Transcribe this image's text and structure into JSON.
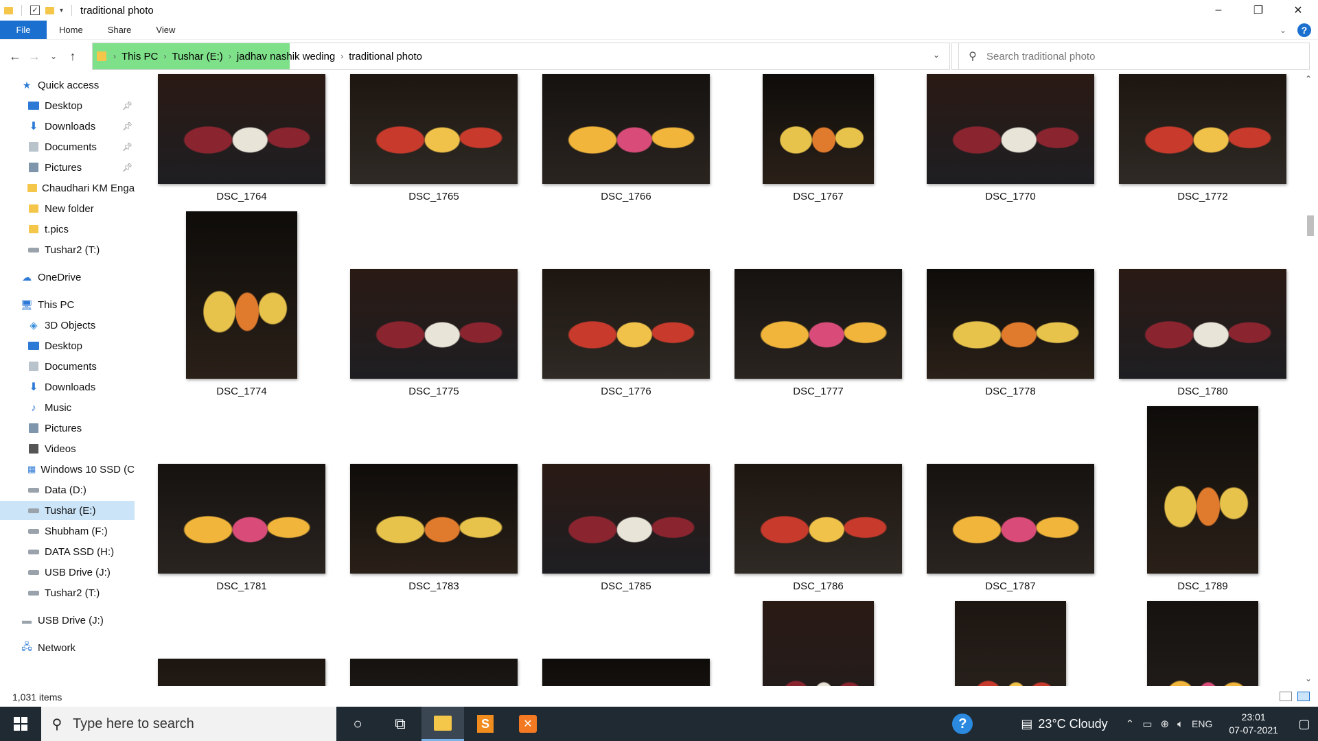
{
  "window": {
    "title": "traditional photo",
    "controls": [
      "–",
      "❐",
      "✕"
    ]
  },
  "ribbon": {
    "tabs": [
      "File",
      "Home",
      "Share",
      "View"
    ]
  },
  "address": {
    "crumbs": [
      "This PC",
      "Tushar (E:)",
      "jadhav nashik weding",
      "traditional photo"
    ],
    "progress_fraction": 0.23,
    "progress_color": "#7fe08a"
  },
  "search": {
    "placeholder": "Search traditional photo"
  },
  "navpane": {
    "quick_access": "Quick access",
    "quick_items": [
      {
        "label": "Desktop",
        "icon": "desktop-icon",
        "pinned": true
      },
      {
        "label": "Downloads",
        "icon": "download-icon",
        "pinned": true
      },
      {
        "label": "Documents",
        "icon": "documents-icon",
        "pinned": true
      },
      {
        "label": "Pictures",
        "icon": "pictures-icon",
        "pinned": true
      },
      {
        "label": "Chaudhari KM Enga",
        "icon": "folder-icon",
        "pinned": false
      },
      {
        "label": "New folder",
        "icon": "folder-icon",
        "pinned": false
      },
      {
        "label": "t.pics",
        "icon": "folder-icon",
        "pinned": false
      },
      {
        "label": "Tushar2 (T:)",
        "icon": "drive-icon",
        "pinned": false
      }
    ],
    "onedrive": "OneDrive",
    "this_pc": "This PC",
    "pc_items": [
      {
        "label": "3D Objects",
        "icon": "3d-objects-icon"
      },
      {
        "label": "Desktop",
        "icon": "desktop-icon"
      },
      {
        "label": "Documents",
        "icon": "documents-icon"
      },
      {
        "label": "Downloads",
        "icon": "download-icon"
      },
      {
        "label": "Music",
        "icon": "music-icon"
      },
      {
        "label": "Pictures",
        "icon": "pictures-icon"
      },
      {
        "label": "Videos",
        "icon": "videos-icon"
      },
      {
        "label": "Windows 10 SSD (C",
        "icon": "windows-drive-icon"
      },
      {
        "label": "Data (D:)",
        "icon": "drive-icon"
      },
      {
        "label": "Tushar (E:)",
        "icon": "drive-icon",
        "selected": true
      },
      {
        "label": "Shubham (F:)",
        "icon": "drive-icon"
      },
      {
        "label": "DATA SSD (H:)",
        "icon": "drive-icon"
      },
      {
        "label": "USB Drive (J:)",
        "icon": "drive-icon"
      },
      {
        "label": "Tushar2 (T:)",
        "icon": "drive-icon"
      }
    ],
    "usb": "USB Drive (J:)",
    "network": "Network"
  },
  "files": [
    {
      "name": "DSC_1764",
      "orientation": "landscape"
    },
    {
      "name": "DSC_1765",
      "orientation": "landscape"
    },
    {
      "name": "DSC_1766",
      "orientation": "landscape"
    },
    {
      "name": "DSC_1767",
      "orientation": "portrait"
    },
    {
      "name": "DSC_1770",
      "orientation": "landscape"
    },
    {
      "name": "DSC_1772",
      "orientation": "landscape"
    },
    {
      "name": "DSC_1774",
      "orientation": "portrait"
    },
    {
      "name": "DSC_1775",
      "orientation": "landscape"
    },
    {
      "name": "DSC_1776",
      "orientation": "landscape"
    },
    {
      "name": "DSC_1777",
      "orientation": "landscape"
    },
    {
      "name": "DSC_1778",
      "orientation": "landscape"
    },
    {
      "name": "DSC_1780",
      "orientation": "landscape"
    },
    {
      "name": "DSC_1781",
      "orientation": "landscape"
    },
    {
      "name": "DSC_1783",
      "orientation": "landscape"
    },
    {
      "name": "DSC_1785",
      "orientation": "landscape"
    },
    {
      "name": "DSC_1786",
      "orientation": "landscape"
    },
    {
      "name": "DSC_1787",
      "orientation": "landscape"
    },
    {
      "name": "DSC_1789",
      "orientation": "portrait"
    },
    {
      "name": "",
      "orientation": "landscape"
    },
    {
      "name": "",
      "orientation": "landscape"
    },
    {
      "name": "",
      "orientation": "landscape"
    },
    {
      "name": "",
      "orientation": "portrait"
    },
    {
      "name": "",
      "orientation": "portrait"
    },
    {
      "name": "",
      "orientation": "portrait"
    }
  ],
  "status": {
    "item_count": "1,031 items"
  },
  "taskbar": {
    "search_placeholder": "Type here to search",
    "weather": "23°C  Cloudy",
    "language": "ENG",
    "time": "23:01",
    "date": "07-07-2021"
  }
}
